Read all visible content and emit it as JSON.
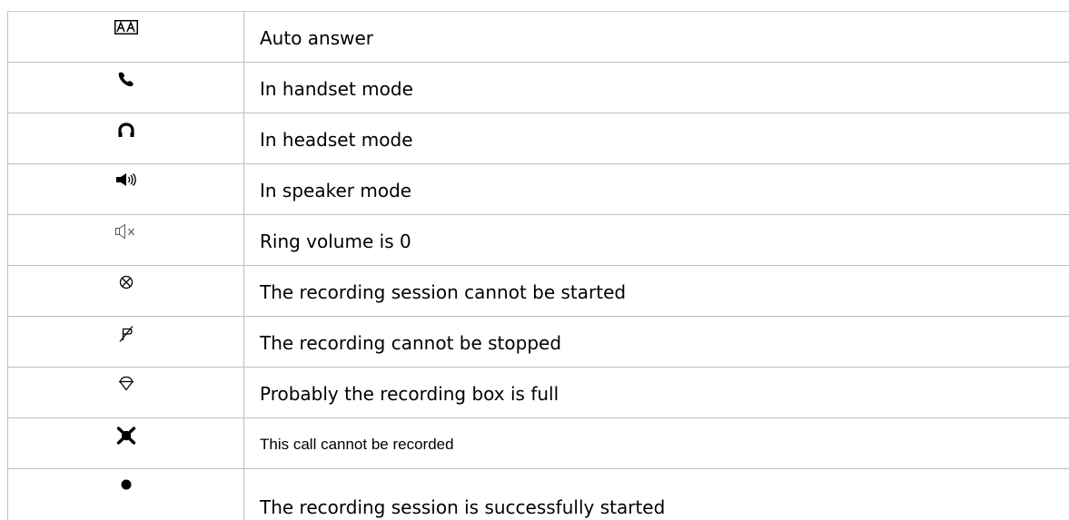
{
  "icon_legend": {
    "rows": [
      {
        "icon": "auto-answer-icon",
        "description": "Auto answer"
      },
      {
        "icon": "handset-icon",
        "description": "In handset mode"
      },
      {
        "icon": "headset-icon",
        "description": "In headset mode"
      },
      {
        "icon": "speaker-icon",
        "description": "In speaker mode"
      },
      {
        "icon": "ring-volume-off-icon",
        "description": "Ring volume is 0"
      },
      {
        "icon": "recording-start-failed-icon",
        "description": "The recording session cannot be started"
      },
      {
        "icon": "recording-stop-failed-icon",
        "description": "The recording cannot be stopped"
      },
      {
        "icon": "recording-box-full-icon",
        "description": "Probably the recording box is full"
      },
      {
        "icon": "call-not-recordable-icon",
        "description": "This call cannot be recorded"
      },
      {
        "icon": "recording-started-icon",
        "description": "The recording session is successfully started"
      }
    ]
  }
}
